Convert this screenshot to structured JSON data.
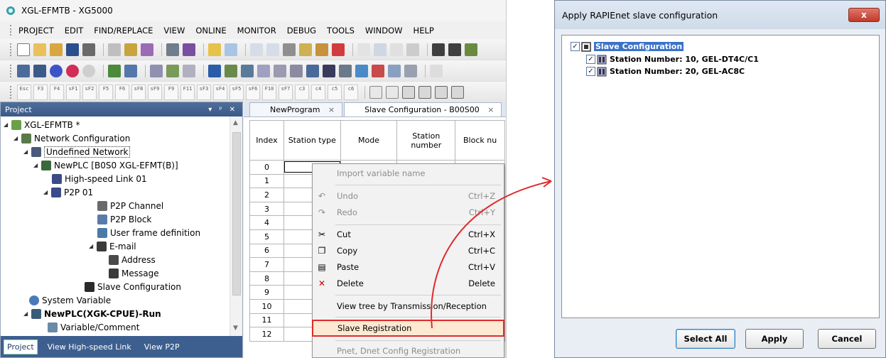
{
  "app": {
    "title": "XGL-EFMTB - XG5000",
    "menu": [
      "PROJECT",
      "EDIT",
      "FIND/REPLACE",
      "VIEW",
      "ONLINE",
      "MONITOR",
      "DEBUG",
      "TOOLS",
      "WINDOW",
      "HELP"
    ]
  },
  "fkeys": [
    "Esc",
    "F3",
    "F4",
    "sF1",
    "sF2",
    "F5",
    "F6",
    "sF8",
    "sF9",
    "F9",
    "F11",
    "sF3",
    "sF4",
    "sF5",
    "sF6",
    "F10",
    "sF7",
    "c3",
    "c4",
    "c5",
    "c6"
  ],
  "project_panel": {
    "title": "Project",
    "controls": [
      "▾",
      "ᵖ",
      "✕"
    ],
    "tree": [
      {
        "label": "XGL-EFMTB *",
        "bold": false
      },
      {
        "label": "Network Configuration",
        "bold": false
      },
      {
        "label": "Undefined Network",
        "bold": false
      },
      {
        "label": "NewPLC [B0S0 XGL-EFMT(B)]",
        "bold": false
      },
      {
        "label": "High-speed Link 01",
        "bold": false
      },
      {
        "label": "P2P 01",
        "bold": false
      },
      {
        "label": "P2P Channel",
        "bold": false
      },
      {
        "label": "P2P Block",
        "bold": false
      },
      {
        "label": "User frame definition",
        "bold": false
      },
      {
        "label": "E-mail",
        "bold": false
      },
      {
        "label": "Address",
        "bold": false
      },
      {
        "label": "Message",
        "bold": false
      },
      {
        "label": "Slave Configuration",
        "bold": false
      },
      {
        "label": "System Variable",
        "bold": false
      },
      {
        "label": "NewPLC(XGK-CPUE)-Run",
        "bold": true
      },
      {
        "label": "Variable/Comment",
        "bold": false
      }
    ],
    "tabs": [
      "Project",
      "View High-speed Link",
      "View P2P"
    ]
  },
  "documents": {
    "tabs": [
      {
        "label": "NewProgram",
        "close": "×"
      },
      {
        "label": "Slave Configuration - B00S00",
        "close": "×"
      }
    ],
    "grid": {
      "headers": [
        "Index",
        "Station type",
        "Mode",
        "Station number",
        "Block nu"
      ],
      "rows": [
        "0",
        "1",
        "2",
        "3",
        "4",
        "5",
        "6",
        "7",
        "8",
        "9",
        "10",
        "11",
        "12"
      ],
      "combo_arrow": "▾"
    }
  },
  "context_menu": {
    "items": [
      {
        "label": "Import variable name",
        "shortcut": "",
        "icon": "",
        "disabled": true
      },
      {
        "label": "Undo",
        "shortcut": "Ctrl+Z",
        "icon": "undo-icon",
        "disabled": true
      },
      {
        "label": "Redo",
        "shortcut": "Ctrl+Y",
        "icon": "redo-icon",
        "disabled": true
      },
      {
        "label": "Cut",
        "shortcut": "Ctrl+X",
        "icon": "scissors-icon",
        "disabled": false
      },
      {
        "label": "Copy",
        "shortcut": "Ctrl+C",
        "icon": "copy-icon",
        "disabled": false
      },
      {
        "label": "Paste",
        "shortcut": "Ctrl+V",
        "icon": "paste-icon",
        "disabled": false
      },
      {
        "label": "Delete",
        "shortcut": "Delete",
        "icon": "delete-icon",
        "disabled": false
      },
      {
        "label": "View tree by Transmission/Reception",
        "shortcut": "",
        "icon": "",
        "disabled": false
      },
      {
        "label": "Slave Registration",
        "shortcut": "",
        "icon": "",
        "disabled": false,
        "highlighted": true
      },
      {
        "label": "Pnet, Dnet Config Registration",
        "shortcut": "",
        "icon": "",
        "disabled": true
      }
    ],
    "highlight_color": "#e02b2b"
  },
  "dialog": {
    "title": "Apply RAPIEnet slave configuration",
    "close": "x",
    "tree": {
      "root": {
        "label": "Slave Configuration",
        "checked": true
      },
      "children": [
        {
          "label": "Station Number: 10, GEL-DT4C/C1",
          "checked": true
        },
        {
          "label": "Station Number: 20, GEL-AC8C",
          "checked": true
        }
      ]
    },
    "checkmark": "✓",
    "buttons": [
      "Select All",
      "Apply",
      "Cancel"
    ]
  },
  "colors": {
    "panel_header": "#3b5a88",
    "accent_red": "#e02b2b",
    "selection_blue": "#3b73c9"
  }
}
